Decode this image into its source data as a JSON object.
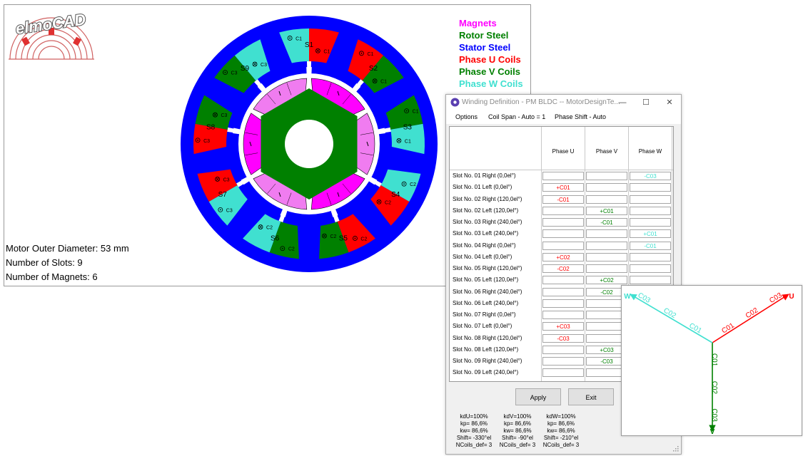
{
  "logo": {
    "text": "elmoCAD"
  },
  "legend": [
    {
      "label": "Magnets",
      "color": "#ff00ff"
    },
    {
      "label": "Rotor Steel",
      "color": "#008000"
    },
    {
      "label": "Stator Steel",
      "color": "#0000ff"
    },
    {
      "label": "Phase U Coils",
      "color": "#ff0000"
    },
    {
      "label": "Phase V Coils",
      "color": "#008000"
    },
    {
      "label": "Phase W Coils",
      "color": "#40e0d0"
    }
  ],
  "motor_info": {
    "outer_diameter": "Motor Outer Diameter: 53 mm",
    "slots": "Number of Slots: 9",
    "magnets": "Number of Magnets: 6"
  },
  "motor_labels": {
    "slots": [
      "S1",
      "S2",
      "S3",
      "S4",
      "S5",
      "S6",
      "S7",
      "S8",
      "S9"
    ],
    "coils": [
      "C1",
      "C2",
      "C3"
    ]
  },
  "colors": {
    "stator": "#0000ff",
    "rotor": "#008000",
    "magnet": "#ff00ff",
    "magnet_light": "#f07cf0",
    "phase_u": "#ff0000",
    "phase_v": "#008000",
    "phase_w": "#40e0d0",
    "window_bg": "#f0f0f0"
  },
  "window": {
    "title": "Winding Definition - PM BLDC -- MotorDesignTe...",
    "menu": [
      "Options",
      "Coil Span - Auto = 1",
      "Phase Shift - Auto"
    ],
    "controls": {
      "minimize": "—",
      "maximize": "☐",
      "close": "✕"
    },
    "columns": [
      "Phase U",
      "Phase V",
      "Phase W"
    ],
    "rows": [
      {
        "label": "Slot No. 01 Right  (0,0el°)",
        "u": "",
        "v": "",
        "w": "-C03"
      },
      {
        "label": "Slot No. 01 Left  (0,0el°)",
        "u": "+C01",
        "v": "",
        "w": ""
      },
      {
        "label": "Slot No. 02 Right  (120,0el°)",
        "u": "-C01",
        "v": "",
        "w": ""
      },
      {
        "label": "Slot No. 02 Left  (120,0el°)",
        "u": "",
        "v": "+C01",
        "w": ""
      },
      {
        "label": "Slot No. 03 Right  (240,0el°)",
        "u": "",
        "v": "-C01",
        "w": ""
      },
      {
        "label": "Slot No. 03 Left  (240,0el°)",
        "u": "",
        "v": "",
        "w": "+C01"
      },
      {
        "label": "Slot No. 04 Right  (0,0el°)",
        "u": "",
        "v": "",
        "w": "-C01"
      },
      {
        "label": "Slot No. 04 Left  (0,0el°)",
        "u": "+C02",
        "v": "",
        "w": ""
      },
      {
        "label": "Slot No. 05 Right  (120,0el°)",
        "u": "-C02",
        "v": "",
        "w": ""
      },
      {
        "label": "Slot No. 05 Left  (120,0el°)",
        "u": "",
        "v": "+C02",
        "w": ""
      },
      {
        "label": "Slot No. 06 Right  (240,0el°)",
        "u": "",
        "v": "-C02",
        "w": ""
      },
      {
        "label": "Slot No. 06 Left  (240,0el°)",
        "u": "",
        "v": "",
        "w": ""
      },
      {
        "label": "Slot No. 07 Right  (0,0el°)",
        "u": "",
        "v": "",
        "w": ""
      },
      {
        "label": "Slot No. 07 Left  (0,0el°)",
        "u": "+C03",
        "v": "",
        "w": ""
      },
      {
        "label": "Slot No. 08 Right  (120,0el°)",
        "u": "-C03",
        "v": "",
        "w": ""
      },
      {
        "label": "Slot No. 08 Left  (120,0el°)",
        "u": "",
        "v": "+C03",
        "w": ""
      },
      {
        "label": "Slot No. 09 Right  (240,0el°)",
        "u": "",
        "v": "-C03",
        "w": ""
      },
      {
        "label": "Slot No. 09 Left  (240,0el°)",
        "u": "",
        "v": "",
        "w": ""
      }
    ],
    "buttons": {
      "apply": "Apply",
      "exit": "Exit"
    },
    "stats": [
      [
        "kdU=100%",
        "kp= 86,6%",
        "kw= 86,6%",
        "Shift= -330°el",
        "NCoils_def= 3"
      ],
      [
        "kdV=100%",
        "kp= 86,6%",
        "kw= 86,6%",
        "Shift= -90°el",
        "NCoils_def= 3"
      ],
      [
        "kdW=100%",
        "kp= 86,6%",
        "kw= 86,6%",
        "Shift= -210°el",
        "NCoils_def= 3"
      ]
    ]
  },
  "vector_diagram": {
    "phases": [
      {
        "name": "U",
        "coils": [
          "C01",
          "C02",
          "C03"
        ]
      },
      {
        "name": "V",
        "coils": [
          "C01",
          "C02",
          "C03"
        ]
      },
      {
        "name": "W",
        "coils": [
          "C01",
          "C02",
          "C03"
        ]
      }
    ]
  }
}
